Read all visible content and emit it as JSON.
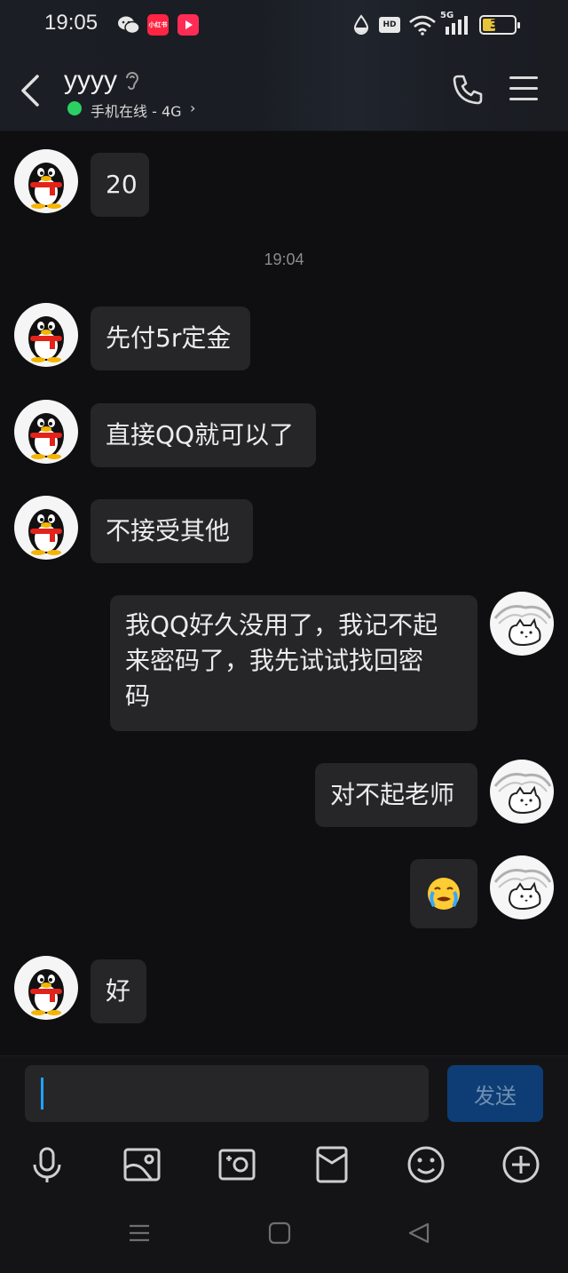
{
  "status_bar": {
    "time": "19:05",
    "app_badge_text": "小红书",
    "network": "5G",
    "battery": "39",
    "hd_label": "HD"
  },
  "header": {
    "contact_name": "yyyy",
    "online_status": "手机在线 - 4G",
    "online_color": "#2bd063"
  },
  "chat": {
    "timestamp": "19:04",
    "messages": [
      {
        "from": "them",
        "text": "20"
      },
      {
        "from": "them",
        "text": "先付5r定金"
      },
      {
        "from": "them",
        "text": "直接QQ就可以了"
      },
      {
        "from": "them",
        "text": "不接受其他"
      },
      {
        "from": "me",
        "lines": [
          "我QQ好久没用了，我记不起",
          "来密码了，我先试试找回密",
          "码"
        ]
      },
      {
        "from": "me",
        "text": "对不起老师"
      },
      {
        "from": "me",
        "emoji": "😭"
      },
      {
        "from": "them",
        "text": "好"
      }
    ]
  },
  "input": {
    "send_label": "发送",
    "accent": "#1fa3ff"
  },
  "toolbar": [
    "mic-icon",
    "image-icon",
    "camera-icon",
    "red-packet-icon",
    "emoji-icon",
    "plus-icon"
  ],
  "nav": [
    "menu-nav-icon",
    "home-nav-icon",
    "back-nav-icon"
  ]
}
